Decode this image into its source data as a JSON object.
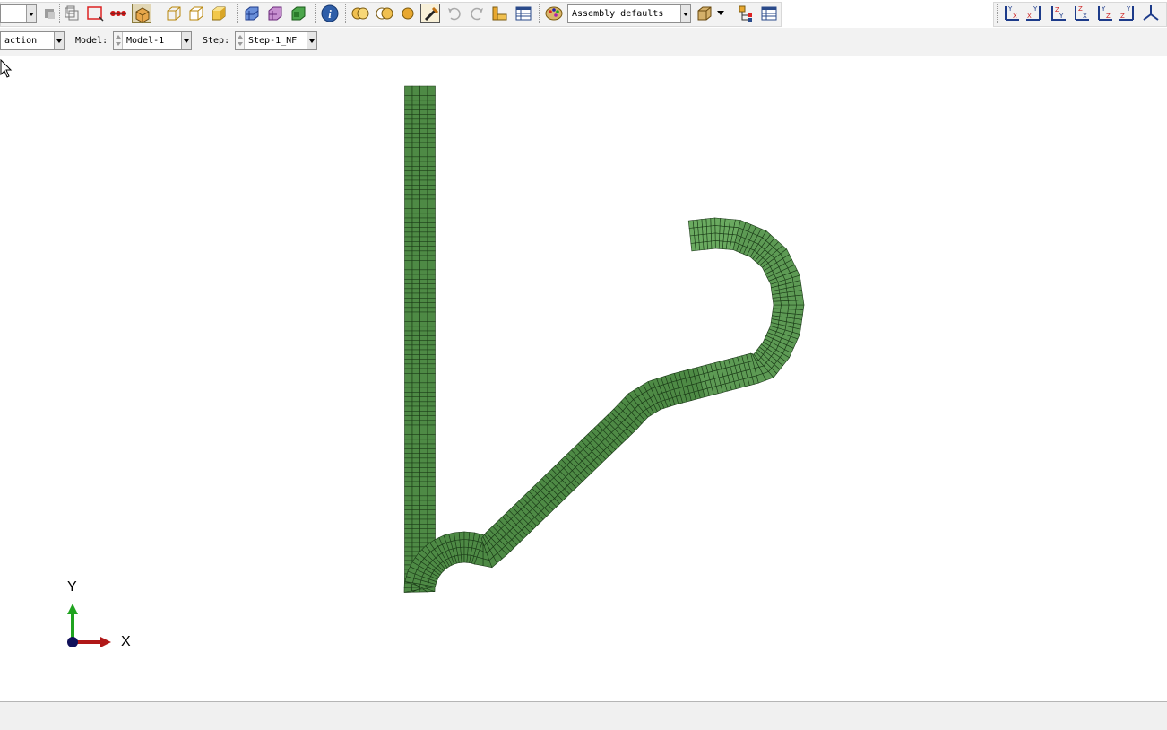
{
  "toolbar": {
    "module_combo_value": "",
    "render_style": "Assembly defaults",
    "view_axes": [
      "view-xy-icon",
      "view-yx-icon",
      "view-yz-icon",
      "view-zy-icon",
      "view-zx-icon",
      "view-xz-icon",
      "view-iso-icon"
    ]
  },
  "context": {
    "module_value": "action",
    "model_label": "Model:",
    "model_value": "Model-1",
    "step_label": "Step:",
    "step_value": "Step-1_NF"
  },
  "viewport": {
    "mesh_color": "#4e8a45",
    "mesh_edge_color": "#1a3a17",
    "triad": {
      "y_label": "Y",
      "x_label": "X",
      "y_color": "#1fa31f",
      "x_color": "#b01818",
      "origin_color": "#10105a"
    }
  },
  "statusbar": {
    "message": ""
  }
}
